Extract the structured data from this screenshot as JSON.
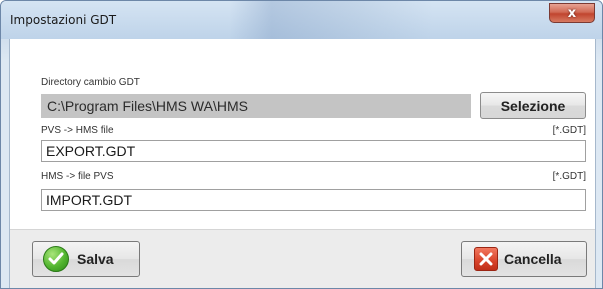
{
  "window": {
    "title": "Impostazioni GDT",
    "close_glyph": "x"
  },
  "form": {
    "directory": {
      "label": "Directory cambio GDT",
      "value": "C:\\Program Files\\HMS WA\\HMS",
      "button_label": "Selezione"
    },
    "export": {
      "label": "PVS -> HMS file",
      "extension": "[*.GDT]",
      "value": "EXPORT.GDT"
    },
    "import": {
      "label": "HMS -> file PVS",
      "extension": "[*.GDT]",
      "value": "IMPORT.GDT"
    }
  },
  "actions": {
    "save_label": "Salva",
    "cancel_label": "Cancella"
  },
  "icons": {
    "save": "check-circle-icon",
    "cancel": "x-square-icon",
    "close": "close-icon"
  },
  "colors": {
    "save_icon": "#52b52f",
    "cancel_icon": "#d8432a",
    "close_button": "#c1452f"
  }
}
